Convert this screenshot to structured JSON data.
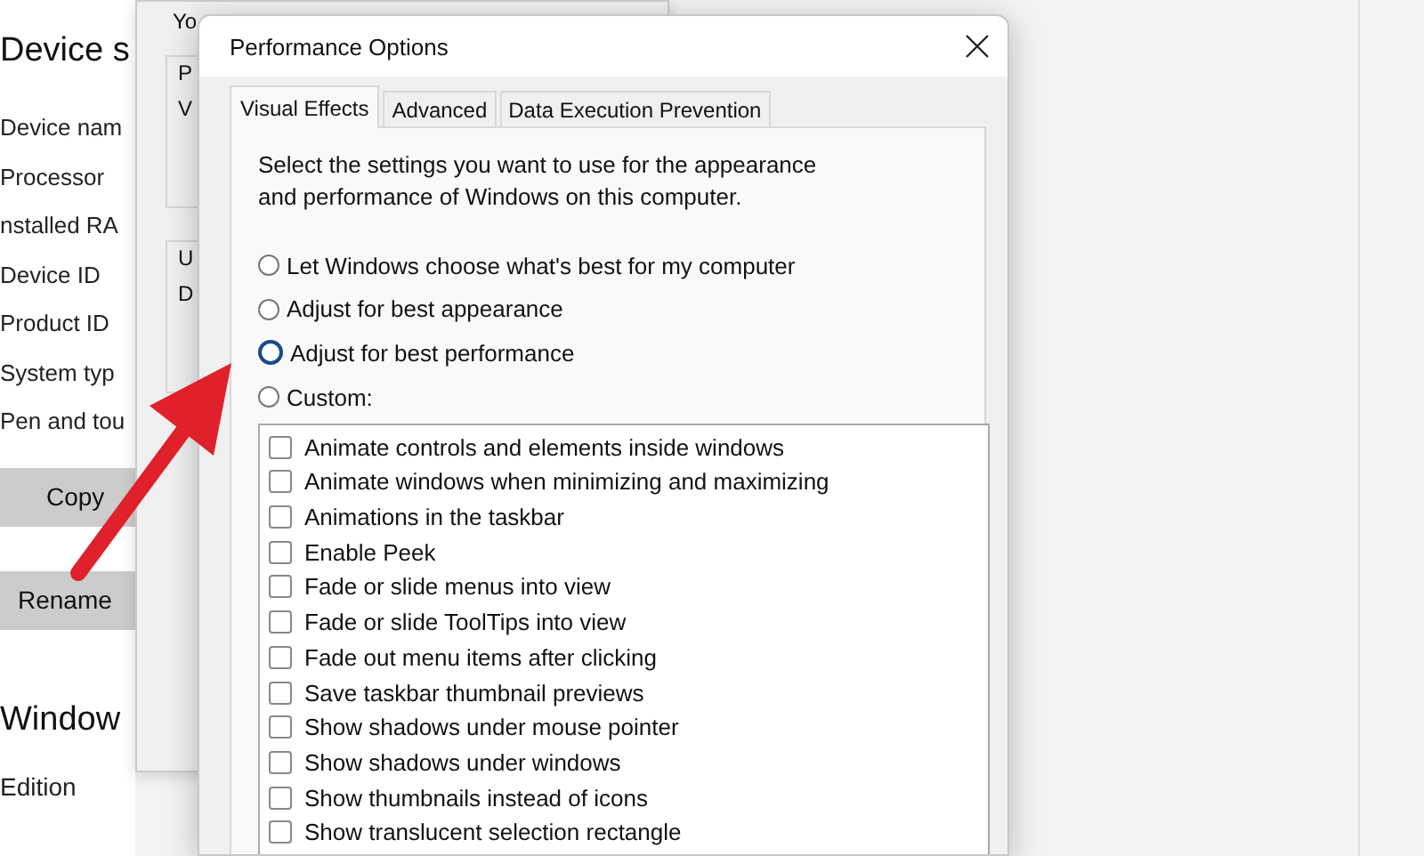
{
  "settings_page": {
    "heading": "Device s",
    "specs": [
      "Device nam",
      "Processor",
      "nstalled RA",
      "Device ID",
      "Product ID",
      "System typ",
      "Pen and tou"
    ],
    "buttons": [
      "Copy",
      "Rename"
    ],
    "section_heading": "Window",
    "section_items": [
      "Edition"
    ]
  },
  "background_dialog": {
    "intro": "Yo",
    "groups": [
      {
        "lines": [
          "P",
          "V"
        ]
      },
      {
        "lines": [
          "U",
          "D"
        ]
      }
    ]
  },
  "dialog": {
    "title": "Performance Options",
    "tabs": [
      {
        "label": "Visual Effects",
        "selected": true
      },
      {
        "label": "Advanced",
        "selected": false
      },
      {
        "label": "Data Execution Prevention",
        "selected": false
      }
    ],
    "description": "Select the settings you want to use for the appearance and performance of Windows on this computer.",
    "options": [
      {
        "label": "Let Windows choose what's best for my computer",
        "selected": false
      },
      {
        "label": "Adjust for best appearance",
        "selected": false
      },
      {
        "label": "Adjust for best performance",
        "selected": true
      },
      {
        "label": "Custom:",
        "selected": false
      }
    ],
    "effects": [
      {
        "label": "Animate controls and elements inside windows",
        "checked": false
      },
      {
        "label": "Animate windows when minimizing and maximizing",
        "checked": false
      },
      {
        "label": "Animations in the taskbar",
        "checked": false
      },
      {
        "label": "Enable Peek",
        "checked": false
      },
      {
        "label": "Fade or slide menus into view",
        "checked": false
      },
      {
        "label": "Fade or slide ToolTips into view",
        "checked": false
      },
      {
        "label": "Fade out menu items after clicking",
        "checked": false
      },
      {
        "label": "Save taskbar thumbnail previews",
        "checked": false
      },
      {
        "label": "Show shadows under mouse pointer",
        "checked": false
      },
      {
        "label": "Show shadows under windows",
        "checked": false
      },
      {
        "label": "Show thumbnails instead of icons",
        "checked": false
      },
      {
        "label": "Show translucent selection rectangle",
        "checked": false
      }
    ]
  }
}
